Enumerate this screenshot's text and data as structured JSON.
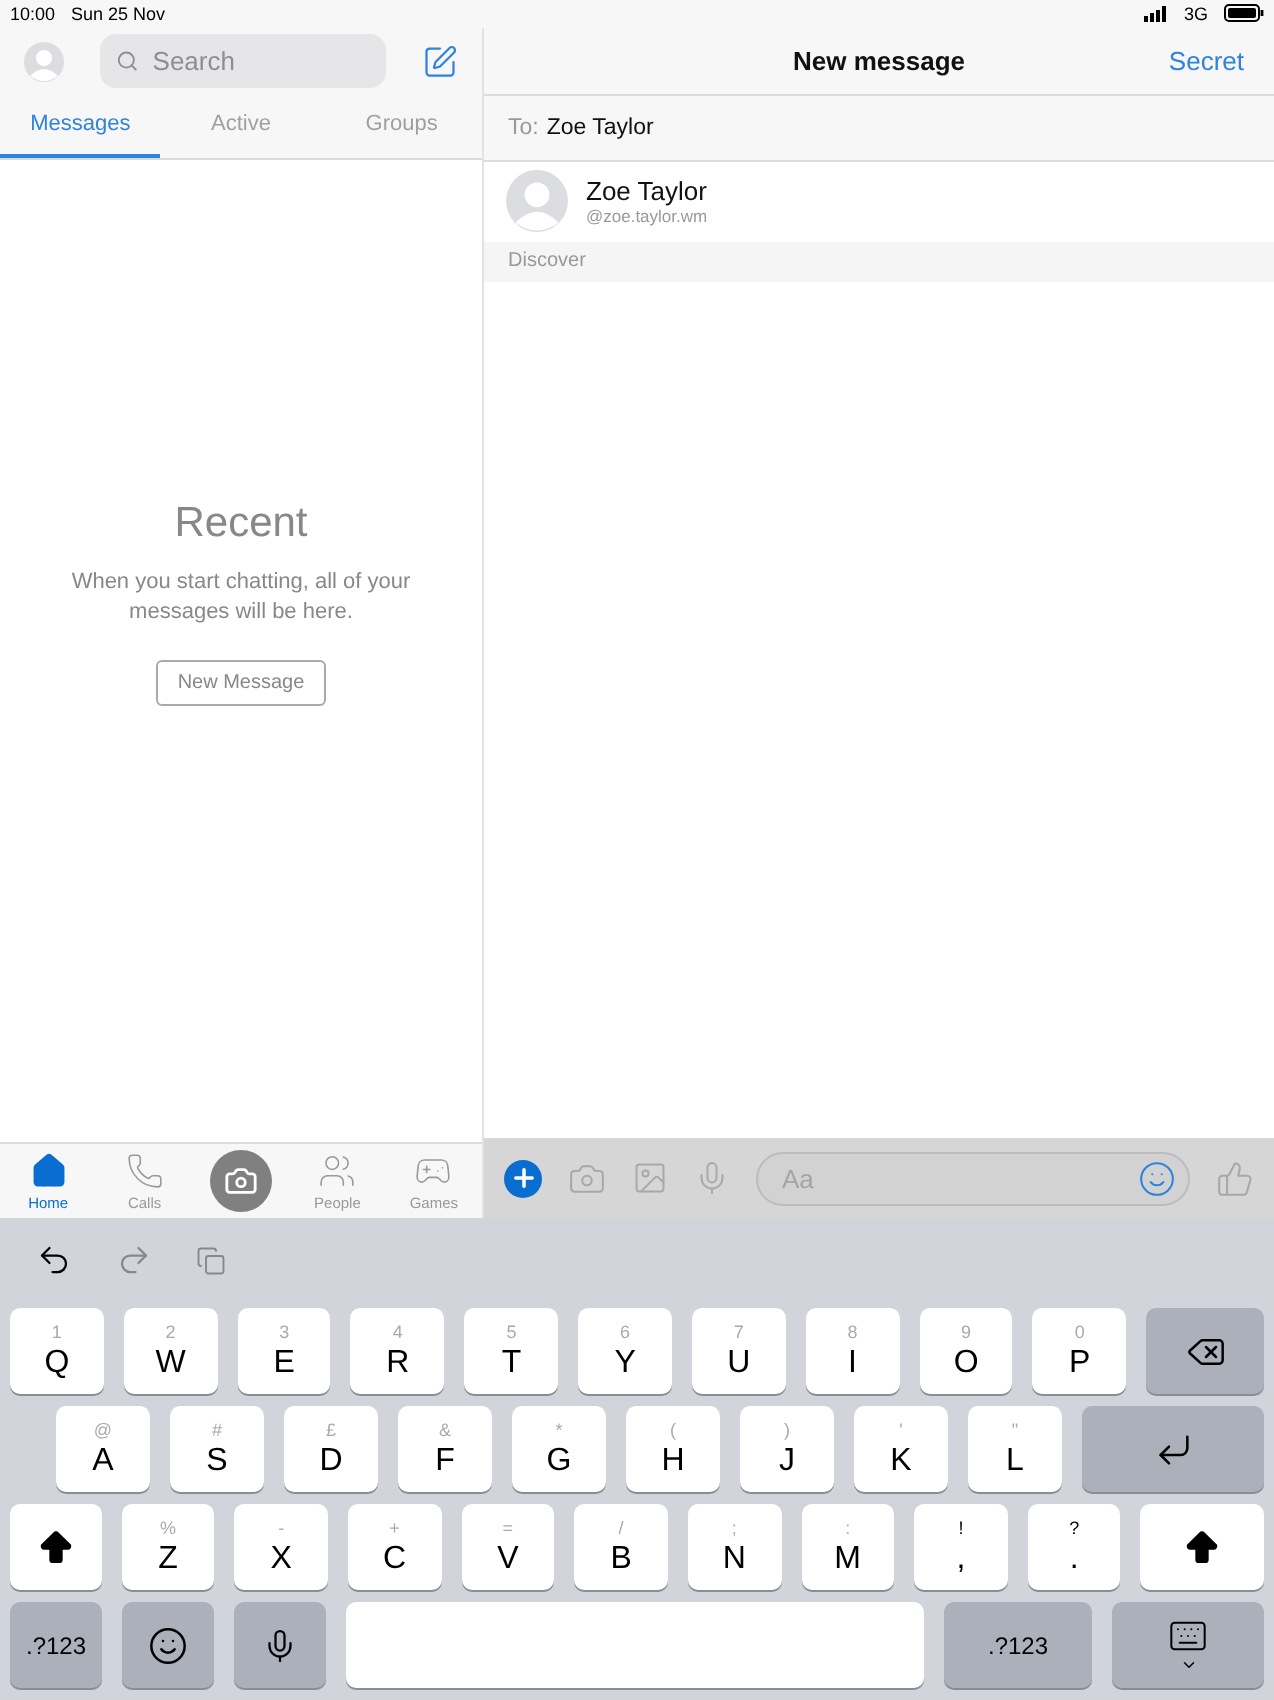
{
  "status_bar": {
    "time": "10:00",
    "date": "Sun 25 Nov",
    "network": "3G"
  },
  "sidebar": {
    "search": {
      "placeholder": "Search"
    },
    "tabs": [
      {
        "label": "Messages",
        "selected": true
      },
      {
        "label": "Active",
        "selected": false
      },
      {
        "label": "Groups",
        "selected": false
      }
    ],
    "empty_state": {
      "title": "Recent",
      "text": "When you start chatting, all of your messages will be here.",
      "button": "New Message"
    },
    "nav": [
      {
        "kind": "home",
        "label": "Home",
        "selected": true
      },
      {
        "kind": "calls",
        "label": "Calls",
        "selected": false
      },
      {
        "kind": "camera",
        "selected": false
      },
      {
        "kind": "people",
        "label": "People",
        "selected": false
      },
      {
        "kind": "games",
        "label": "Games",
        "selected": false
      }
    ]
  },
  "conversation": {
    "title": "New message",
    "action": "Secret",
    "to_label": "To:",
    "to_value": "Zoe Taylor",
    "contacts": [
      {
        "name": "Zoe Taylor",
        "username": "@zoe.taylor.wm"
      }
    ],
    "section": "Discover",
    "composer": {
      "placeholder": "Aa"
    }
  },
  "keyboard": {
    "rows": [
      [
        {
          "kind": "letter",
          "hint": "1",
          "label": "Q"
        },
        {
          "kind": "letter",
          "hint": "2",
          "label": "W"
        },
        {
          "kind": "letter",
          "hint": "3",
          "label": "E"
        },
        {
          "kind": "letter",
          "hint": "4",
          "label": "R"
        },
        {
          "kind": "letter",
          "hint": "5",
          "label": "T"
        },
        {
          "kind": "letter",
          "hint": "6",
          "label": "Y"
        },
        {
          "kind": "letter",
          "hint": "7",
          "label": "U"
        },
        {
          "kind": "letter",
          "hint": "8",
          "label": "I"
        },
        {
          "kind": "letter",
          "hint": "9",
          "label": "O"
        },
        {
          "kind": "letter",
          "hint": "0",
          "label": "P"
        },
        {
          "kind": "backspace"
        }
      ],
      [
        {
          "kind": "letter",
          "hint": "@",
          "label": "A"
        },
        {
          "kind": "letter",
          "hint": "#",
          "label": "S"
        },
        {
          "kind": "letter",
          "hint": "£",
          "label": "D"
        },
        {
          "kind": "letter",
          "hint": "&",
          "label": "F"
        },
        {
          "kind": "letter",
          "hint": "*",
          "label": "G"
        },
        {
          "kind": "letter",
          "hint": "(",
          "label": "H"
        },
        {
          "kind": "letter",
          "hint": ")",
          "label": "J"
        },
        {
          "kind": "letter",
          "hint": "'",
          "label": "K"
        },
        {
          "kind": "letter",
          "hint": "\"",
          "label": "L"
        },
        {
          "kind": "return"
        }
      ],
      [
        {
          "kind": "shift"
        },
        {
          "kind": "letter",
          "hint": "%",
          "label": "Z"
        },
        {
          "kind": "letter",
          "hint": "-",
          "label": "X"
        },
        {
          "kind": "letter",
          "hint": "+",
          "label": "C"
        },
        {
          "kind": "letter",
          "hint": "=",
          "label": "V"
        },
        {
          "kind": "letter",
          "hint": "/",
          "label": "B"
        },
        {
          "kind": "letter",
          "hint": ";",
          "label": "N"
        },
        {
          "kind": "letter",
          "hint": ":",
          "label": "M"
        },
        {
          "kind": "punct",
          "hint": "!",
          "label": ","
        },
        {
          "kind": "punct",
          "hint": "?",
          "label": "."
        },
        {
          "kind": "shift"
        }
      ],
      [
        {
          "kind": "mode",
          "label": ".?123"
        },
        {
          "kind": "emoji"
        },
        {
          "kind": "mic"
        },
        {
          "kind": "space"
        },
        {
          "kind": "mode",
          "label": ".?123"
        },
        {
          "kind": "hide"
        }
      ]
    ]
  }
}
